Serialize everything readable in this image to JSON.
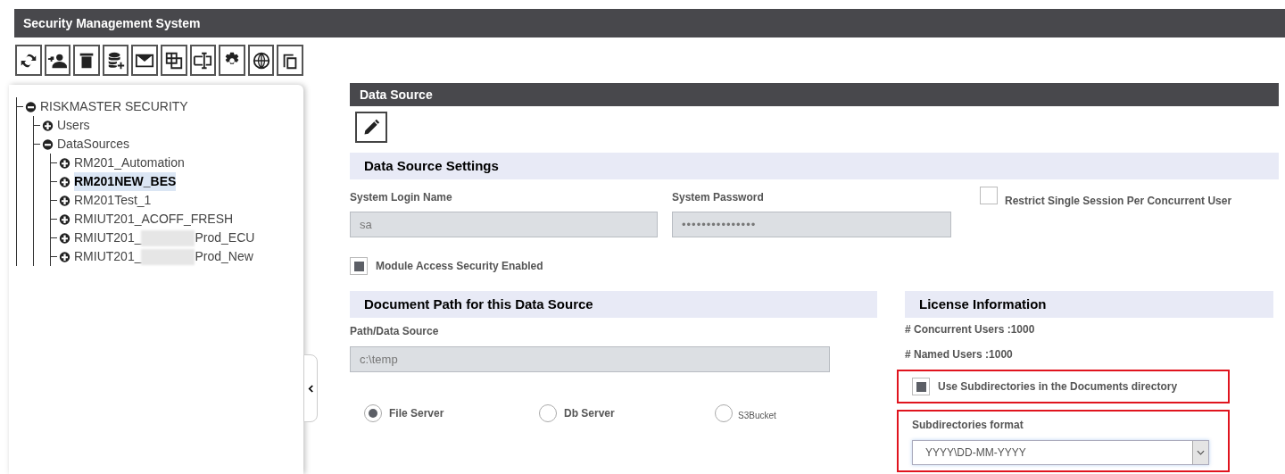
{
  "window": {
    "title": "Security Management System"
  },
  "toolbar": [
    {
      "kind": "refresh"
    },
    {
      "kind": "add-user"
    },
    {
      "kind": "delete"
    },
    {
      "kind": "add-database"
    },
    {
      "kind": "mail"
    },
    {
      "kind": "layout"
    },
    {
      "kind": "rename"
    },
    {
      "kind": "settings"
    },
    {
      "kind": "globe"
    },
    {
      "kind": "copy"
    }
  ],
  "tree": {
    "label": "RISKMASTER SECURITY",
    "expanded": true,
    "selected": false,
    "children": [
      {
        "label": "Users",
        "expanded": false,
        "selected": false
      },
      {
        "label": "DataSources",
        "expanded": true,
        "selected": false,
        "children": [
          {
            "label": "RM201_Automation",
            "expanded": false,
            "selected": false
          },
          {
            "label": "RM201NEW_BES",
            "expanded": false,
            "selected": true
          },
          {
            "label": "RM201Test_1",
            "expanded": false,
            "selected": false
          },
          {
            "label": "RMIUT201_ACOFF_FRESH",
            "expanded": false,
            "selected": false
          },
          {
            "label": "RMIUT201_",
            "label_after_redaction": "Prod_ECU",
            "expanded": false,
            "selected": false
          },
          {
            "label": "RMIUT201_",
            "label_after_redaction": "Prod_New",
            "expanded": false,
            "selected": false
          }
        ]
      }
    ]
  },
  "panel": {
    "title": "Data Source",
    "settings": {
      "title": "Data Source Settings",
      "login_label": "System Login Name",
      "login_value": "sa",
      "password_label": "System Password",
      "password_value": "•••••••••••••••",
      "restrict_label": "Restrict Single Session Per Concurrent User",
      "restrict_checked": false,
      "module_label": "Module Access Security Enabled",
      "module_checked": true
    },
    "document_path": {
      "title": "Document Path for this Data Source",
      "path_label": "Path/Data Source",
      "path_value": "c:\\temp",
      "options": [
        {
          "label": "File Server",
          "selected": true,
          "kind": "normal"
        },
        {
          "label": "Db Server",
          "selected": false,
          "kind": "normal"
        },
        {
          "label": "S3Bucket",
          "selected": false,
          "kind": "small"
        }
      ]
    },
    "license": {
      "title": "License Information",
      "concurrent": "# Concurrent Users :1000",
      "named": "# Named Users :1000",
      "subdirs_label": "Use Subdirectories in the Documents directory",
      "subdirs_checked": true,
      "format_label": "Subdirectories format",
      "format_value": "YYYY\\DD-MM-YYYY"
    }
  }
}
